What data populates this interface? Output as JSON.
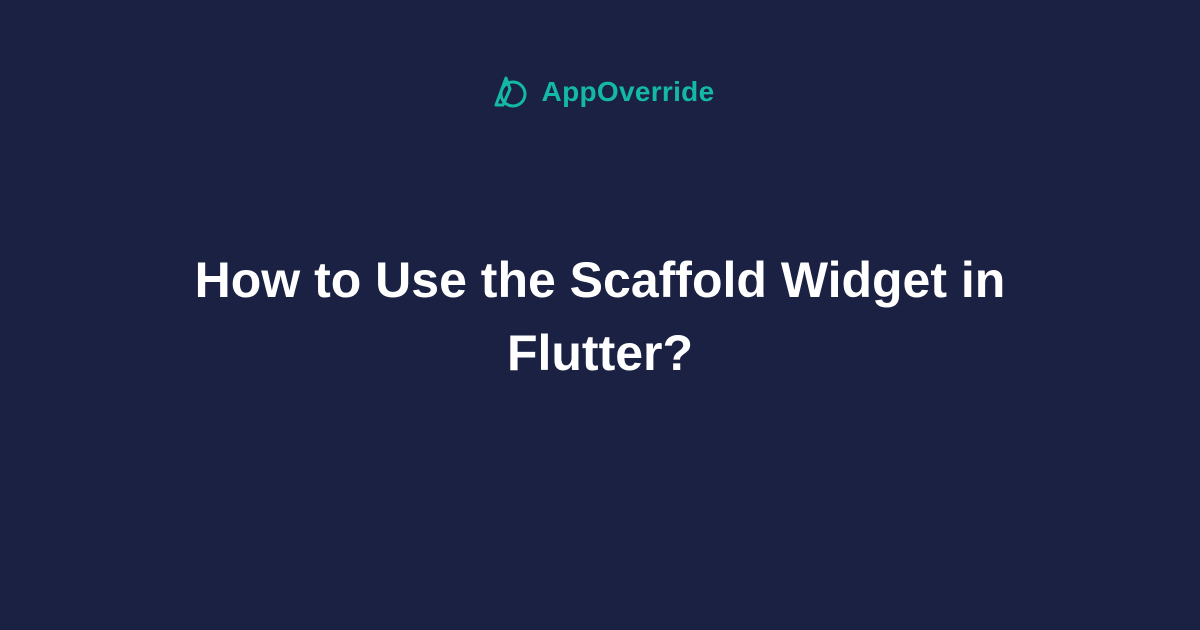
{
  "brand": {
    "name": "AppOverride",
    "accent_color": "#14b8a6"
  },
  "title": "How to Use the Scaffold Widget in Flutter?",
  "colors": {
    "background": "#1a2142",
    "text": "#ffffff",
    "accent": "#14b8a6"
  }
}
